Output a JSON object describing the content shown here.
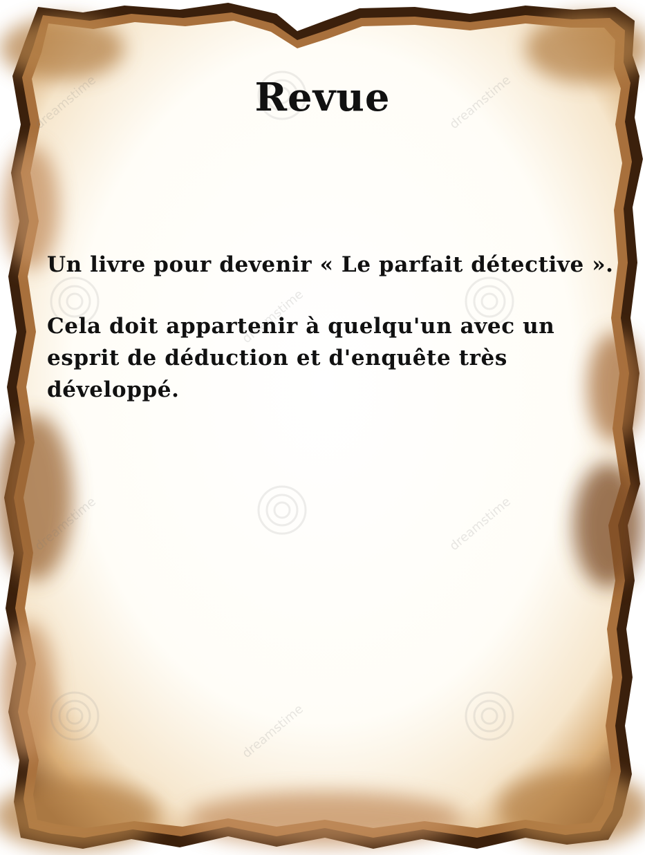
{
  "document": {
    "title": "Revue",
    "lines": [
      "Un livre pour devenir « Le parfait détective ».",
      "Cela doit appartenir à quelqu'un avec un",
      "esprit de déduction et d'enquête très développé."
    ]
  },
  "watermark": {
    "text": "dreamstime"
  },
  "colors": {
    "paper": "#fffdf8",
    "burn_edge": "#3b200c",
    "scorch": "#c9965e",
    "text": "#111111"
  }
}
